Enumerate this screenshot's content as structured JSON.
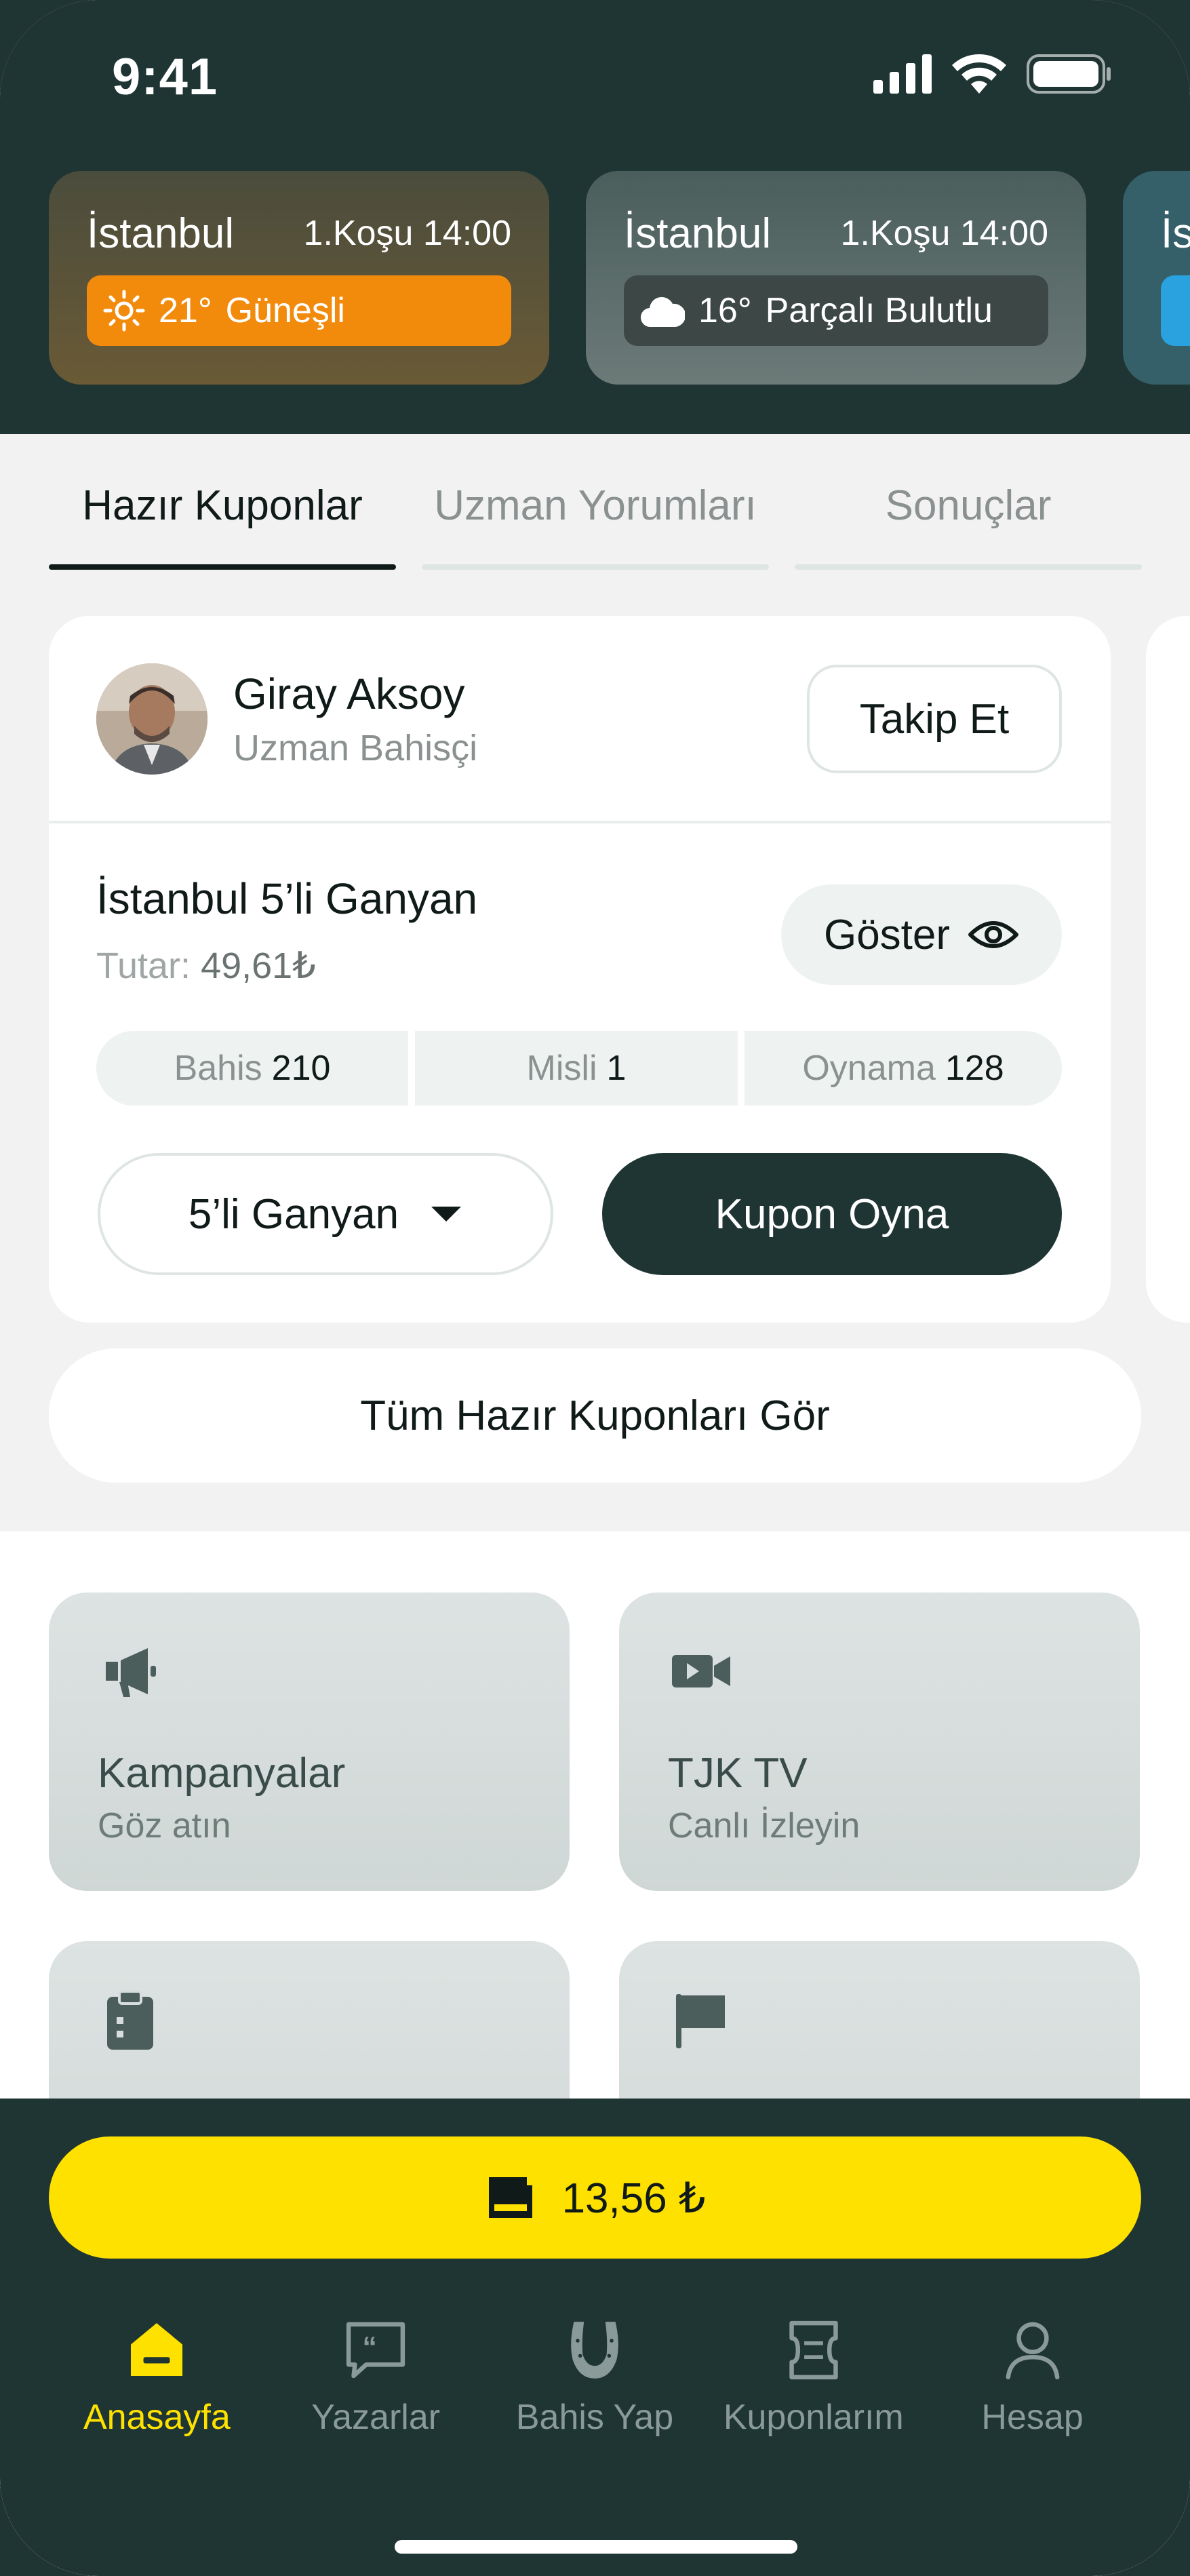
{
  "status_bar": {
    "time": "9:41"
  },
  "weather_cards": [
    {
      "city": "İstanbul",
      "race": "1.Koşu 14:00",
      "temp": "21°",
      "condition": "Güneşli",
      "icon": "sun-icon"
    },
    {
      "city": "İstanbul",
      "race": "1.Koşu 14:00",
      "temp": "16°",
      "condition": "Parçalı Bulutlu",
      "icon": "cloud-icon"
    },
    {
      "city": "İs",
      "icon": "partial-weather-icon"
    }
  ],
  "tabs": [
    {
      "label": "Hazır Kuponlar",
      "active": true
    },
    {
      "label": "Uzman Yorumları",
      "active": false
    },
    {
      "label": "Sonuçlar",
      "active": false
    }
  ],
  "coupon": {
    "author_name": "Giray Aksoy",
    "author_role": "Uzman Bahisçi",
    "follow_label": "Takip Et",
    "title": "İstanbul 5’li Ganyan",
    "amount_label": "Tutar:",
    "amount_value": "49,61₺",
    "show_label": "Göster",
    "stats": [
      {
        "label": "Bahis",
        "value": "210"
      },
      {
        "label": "Misli",
        "value": "1"
      },
      {
        "label": "Oynama",
        "value": "128"
      }
    ],
    "bet_type": "5’li Ganyan",
    "play_label": "Kupon Oyna"
  },
  "all_coupons_label": "Tüm Hazır Kuponları Gör",
  "tiles": [
    {
      "title": "Kampanyalar",
      "subtitle": "Göz atın",
      "icon": "megaphone-icon"
    },
    {
      "title": "TJK TV",
      "subtitle": "Canlı İzleyin",
      "icon": "video-camera-icon"
    },
    {
      "title": "",
      "subtitle": "",
      "icon": "clipboard-icon"
    },
    {
      "title": "",
      "subtitle": "",
      "icon": "flag-icon"
    }
  ],
  "balance": {
    "value": "13,56 ₺",
    "icon": "ticket-icon"
  },
  "nav": [
    {
      "label": "Anasayfa",
      "icon": "home-icon",
      "active": true
    },
    {
      "label": "Yazarlar",
      "icon": "quote-bubble-icon",
      "active": false
    },
    {
      "label": "Bahis Yap",
      "icon": "horseshoe-icon",
      "active": false
    },
    {
      "label": "Kuponlarım",
      "icon": "coupon-icon",
      "active": false
    },
    {
      "label": "Hesap",
      "icon": "user-icon",
      "active": false
    }
  ],
  "colors": {
    "primary_dark": "#1f3533",
    "accent_yellow": "#ffe100",
    "sunny_orange": "#f28a0c",
    "tile_bg": "#d6dddc"
  }
}
